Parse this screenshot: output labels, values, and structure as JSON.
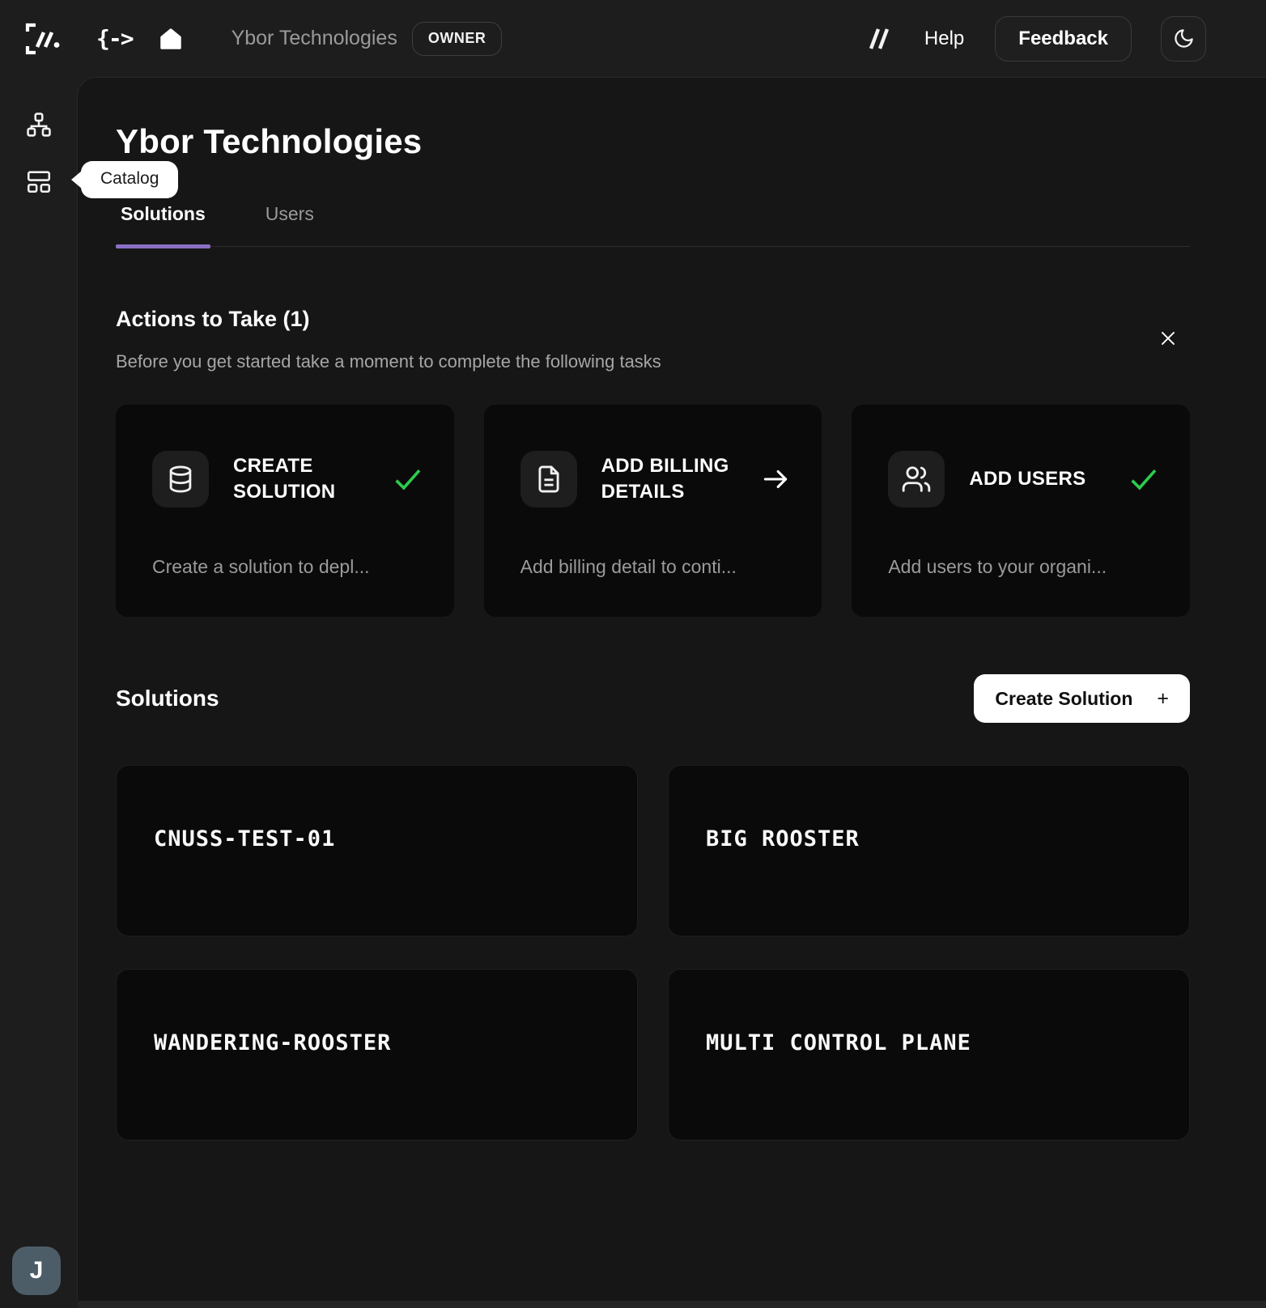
{
  "colors": {
    "accent_purple": "#8B6FC4",
    "check_green": "#2BCC4E",
    "avatar_bg": "#4C5D68"
  },
  "topbar": {
    "brand_arrow": "{->",
    "org_title": "Ybor Technologies",
    "owner_badge": "OWNER",
    "help_label": "Help",
    "feedback_label": "Feedback",
    "icons": [
      "brand-logo-icon",
      "home-icon",
      "slashes-icon",
      "moon-icon"
    ]
  },
  "sidebar": {
    "icons": [
      "org-hierarchy-icon",
      "catalog-icon"
    ],
    "tooltip": "Catalog",
    "avatar_initial": "J"
  },
  "page": {
    "title": "Ybor Technologies",
    "tabs": [
      {
        "label": "Solutions",
        "active": true
      },
      {
        "label": "Users",
        "active": false
      }
    ]
  },
  "actions_panel": {
    "title": "Actions to Take (1)",
    "subtitle": "Before you get started take a moment to complete the following tasks",
    "cards": [
      {
        "title": "CREATE SOLUTION",
        "icon": "database-icon",
        "status": "done",
        "description": "Create a solution to depl..."
      },
      {
        "title": "ADD BILLING DETAILS",
        "icon": "file-text-icon",
        "status": "arrow",
        "description": "Add billing detail to conti..."
      },
      {
        "title": "ADD USERS",
        "icon": "users-icon",
        "status": "done",
        "description": "Add users to your organi..."
      }
    ]
  },
  "solutions": {
    "title": "Solutions",
    "create_button": "Create Solution",
    "create_button_plus": "+",
    "items": [
      {
        "name": "CNUSS-TEST-01",
        "color": "#FB7500"
      },
      {
        "name": "BIG ROOSTER",
        "color": "#7B6CFB"
      },
      {
        "name": "WANDERING-ROOSTER",
        "color": "#F82558"
      },
      {
        "name": "MULTI CONTROL PLANE",
        "color": "#1ABBDB"
      }
    ]
  }
}
